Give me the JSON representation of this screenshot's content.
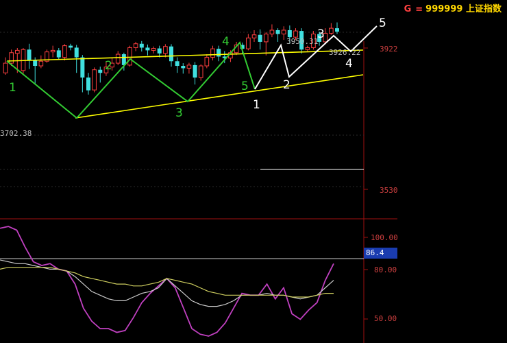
{
  "header": {
    "marker": "G",
    "menu_icon": "hamburger-icon",
    "code": "999999",
    "name": "上证指数"
  },
  "colors": {
    "background": "#000000",
    "bull_candle": "#ff4040",
    "bear_candle": "#40e0e0",
    "axis": "#a01010",
    "trendline": "#ffff00",
    "wave_green": "#33cc33",
    "wave_white": "#ffffff",
    "osc_purple": "#c040c0",
    "osc_white": "#cccccc",
    "osc_yellow": "#d0d060",
    "osc_tag_bg": "#1a3cb0"
  },
  "chart_data": [
    {
      "type": "candlestick",
      "title": "",
      "y_axis_labels": [
        "3922",
        "3530"
      ],
      "price_annotations": {
        "high": "3950.31",
        "last": "3926.22",
        "low": "3702.38"
      },
      "ylim": [
        3460,
        3990
      ],
      "candles": [
        [
          3820,
          3845,
          3815,
          3860
        ],
        [
          3845,
          3872,
          3838,
          3880
        ],
        [
          3870,
          3878,
          3820,
          3884
        ],
        [
          3826,
          3880,
          3818,
          3884
        ],
        [
          3880,
          3852,
          3830,
          3895
        ],
        [
          3852,
          3838,
          3790,
          3860
        ],
        [
          3838,
          3850,
          3832,
          3865
        ],
        [
          3850,
          3874,
          3846,
          3880
        ],
        [
          3874,
          3878,
          3860,
          3890
        ],
        [
          3878,
          3860,
          3855,
          3884
        ],
        [
          3860,
          3890,
          3852,
          3894
        ],
        [
          3890,
          3885,
          3878,
          3895
        ],
        [
          3885,
          3860,
          3820,
          3892
        ],
        [
          3860,
          3808,
          3770,
          3866
        ],
        [
          3808,
          3775,
          3764,
          3820
        ],
        [
          3776,
          3828,
          3770,
          3834
        ],
        [
          3828,
          3820,
          3795,
          3836
        ],
        [
          3820,
          3835,
          3812,
          3850
        ],
        [
          3835,
          3845,
          3826,
          3858
        ],
        [
          3845,
          3868,
          3840,
          3876
        ],
        [
          3868,
          3840,
          3826,
          3872
        ],
        [
          3840,
          3885,
          3836,
          3890
        ],
        [
          3885,
          3895,
          3876,
          3900
        ],
        [
          3895,
          3885,
          3875,
          3902
        ],
        [
          3885,
          3878,
          3865,
          3893
        ],
        [
          3878,
          3883,
          3870,
          3888
        ],
        [
          3883,
          3870,
          3860,
          3890
        ],
        [
          3870,
          3888,
          3860,
          3894
        ],
        [
          3888,
          3850,
          3836,
          3894
        ],
        [
          3850,
          3838,
          3820,
          3860
        ],
        [
          3838,
          3832,
          3818,
          3845
        ],
        [
          3832,
          3840,
          3818,
          3846
        ],
        [
          3840,
          3808,
          3790,
          3848
        ],
        [
          3808,
          3838,
          3800,
          3842
        ],
        [
          3838,
          3860,
          3832,
          3868
        ],
        [
          3860,
          3882,
          3852,
          3890
        ],
        [
          3882,
          3862,
          3850,
          3890
        ],
        [
          3862,
          3858,
          3845,
          3876
        ],
        [
          3858,
          3872,
          3848,
          3878
        ],
        [
          3872,
          3892,
          3866,
          3900
        ],
        [
          3892,
          3882,
          3870,
          3898
        ],
        [
          3882,
          3910,
          3878,
          3920
        ],
        [
          3910,
          3918,
          3900,
          3930
        ],
        [
          3918,
          3900,
          3880,
          3932
        ],
        [
          3900,
          3920,
          3865,
          3925
        ],
        [
          3920,
          3930,
          3912,
          3945
        ],
        [
          3930,
          3920,
          3900,
          3935
        ],
        [
          3920,
          3930,
          3905,
          3940
        ],
        [
          3930,
          3912,
          3895,
          3942
        ],
        [
          3912,
          3928,
          3905,
          3935
        ],
        [
          3928,
          3880,
          3870,
          3935
        ],
        [
          3880,
          3885,
          3876,
          3890
        ],
        [
          3885,
          3920,
          3880,
          3928
        ],
        [
          3920,
          3900,
          3890,
          3926
        ],
        [
          3900,
          3922,
          3895,
          3935
        ],
        [
          3922,
          3935,
          3918,
          3948
        ],
        [
          3935,
          3926,
          3920,
          3950
        ]
      ],
      "elliott_waves": {
        "green_labels": [
          "1",
          "2",
          "3",
          "4",
          "5"
        ],
        "white_labels": [
          "1",
          "2",
          "3",
          "4",
          "5"
        ]
      }
    },
    {
      "type": "line",
      "title": "",
      "y_axis_labels": [
        "100.00",
        "80.00",
        "50.00"
      ],
      "ylim": [
        45,
        110
      ],
      "last_value_tag": "86.4",
      "series": [
        {
          "color": "#c040c0",
          "values": [
            106,
            107,
            105,
            96,
            88,
            86,
            87,
            84,
            83,
            76,
            63,
            56,
            52,
            52,
            50,
            51,
            58,
            66,
            71,
            75,
            79,
            74,
            63,
            52,
            49,
            48,
            50,
            55,
            63,
            71,
            70,
            70,
            76,
            68,
            74,
            60,
            57,
            62,
            66,
            78,
            87
          ]
        },
        {
          "color": "#cccccc",
          "values": [
            89,
            88,
            87,
            87,
            86,
            85,
            84,
            84,
            83,
            80,
            76,
            72,
            70,
            68,
            67,
            67,
            69,
            71,
            72,
            74,
            79,
            75,
            71,
            67,
            65,
            64,
            64,
            65,
            67,
            70,
            70,
            70,
            71,
            70,
            70,
            69,
            68,
            69,
            70,
            74,
            78
          ]
        },
        {
          "color": "#d0d060",
          "values": [
            84,
            85,
            85,
            85,
            85,
            85,
            85,
            84,
            83,
            82,
            80,
            79,
            78,
            77,
            76,
            76,
            75,
            75,
            76,
            77,
            79,
            78,
            77,
            76,
            74,
            72,
            71,
            70,
            70,
            70,
            70,
            70,
            70,
            70,
            70,
            69,
            69,
            69,
            70,
            71,
            71
          ]
        }
      ]
    }
  ]
}
